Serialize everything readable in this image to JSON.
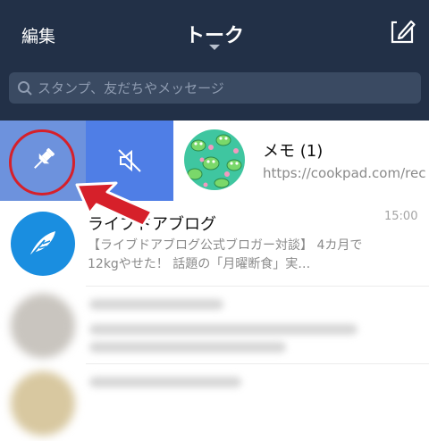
{
  "header": {
    "edit_label": "編集",
    "title": "トーク",
    "compose_icon": "compose-icon",
    "background": "#223047"
  },
  "search": {
    "placeholder": "スタンプ、友だちやメッセージ",
    "icon": "search-icon"
  },
  "swipe_actions": {
    "pin": {
      "icon": "pin-icon",
      "color": "#6d92dd"
    },
    "mute": {
      "icon": "mute-icon",
      "color": "#4f7ee6"
    }
  },
  "chats": [
    {
      "name": "メモ (1)",
      "preview": "https://cookpad.com/rec",
      "avatar": "frog-pattern-avatar"
    },
    {
      "name": "ライブドアブログ",
      "time": "15:00",
      "preview": "【ライブドアブログ公式ブロガー対談】 4カ月で12kgやせた！ 話題の「月曜断食」実…",
      "avatar": "feather-icon",
      "avatar_color": "#1a8ee0"
    }
  ],
  "annotation": {
    "ring_color": "#d6202a",
    "arrow_color": "#d6202a"
  }
}
